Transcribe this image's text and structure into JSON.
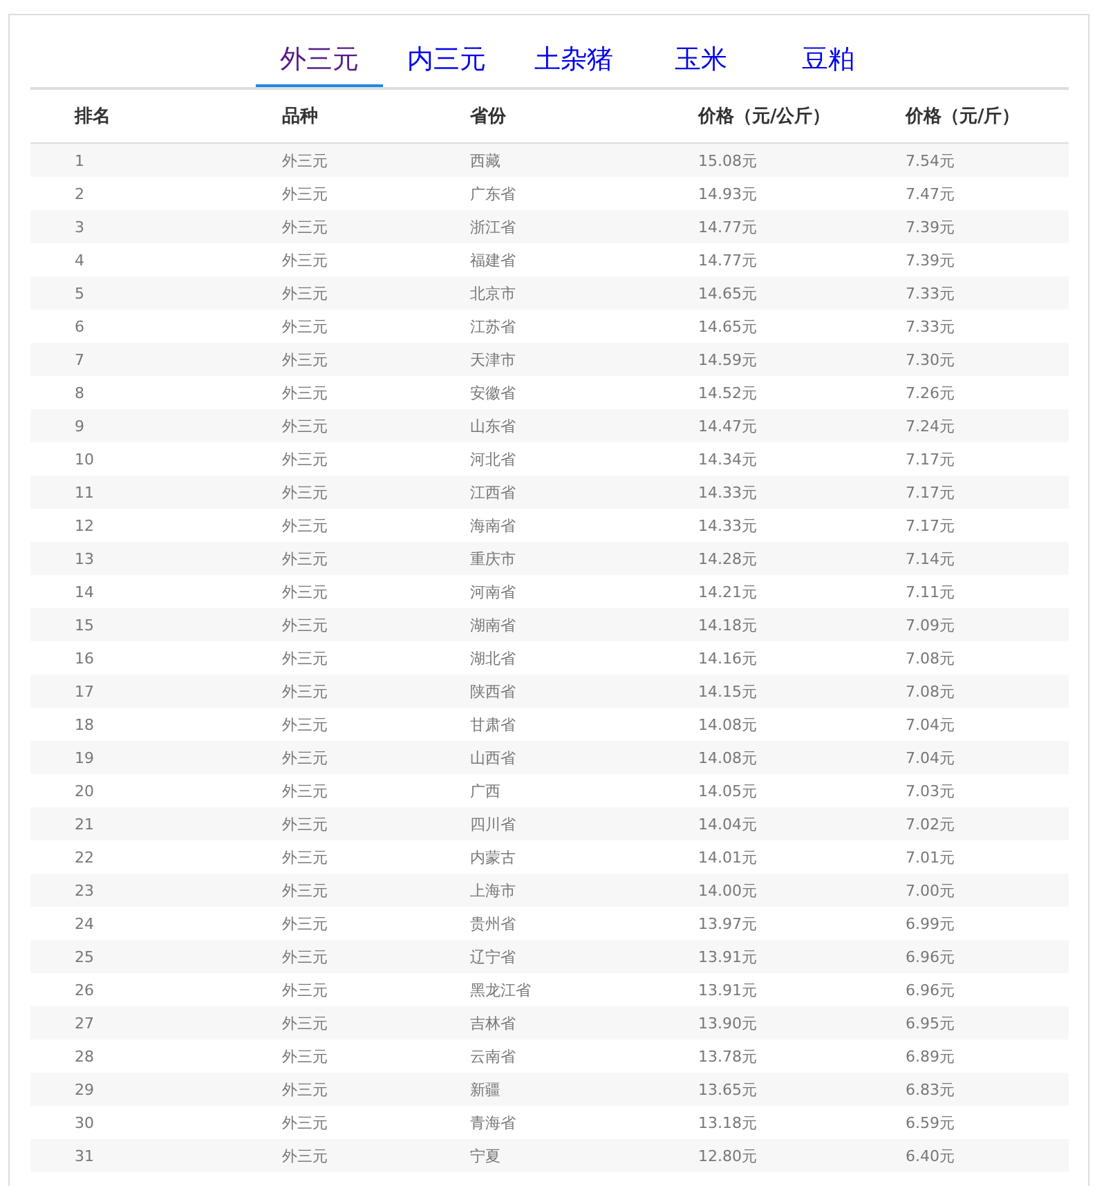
{
  "tabs": [
    {
      "label": "外三元",
      "selected": true
    },
    {
      "label": "内三元",
      "selected": false
    },
    {
      "label": "土杂猪",
      "selected": false
    },
    {
      "label": "玉米",
      "selected": false
    },
    {
      "label": "豆粕",
      "selected": false
    }
  ],
  "table": {
    "columns": [
      "排名",
      "品种",
      "省份",
      "价格（元/公斤）",
      "价格（元/斤）"
    ],
    "rows": [
      [
        "1",
        "外三元",
        "西藏",
        "15.08元",
        "7.54元"
      ],
      [
        "2",
        "外三元",
        "广东省",
        "14.93元",
        "7.47元"
      ],
      [
        "3",
        "外三元",
        "浙江省",
        "14.77元",
        "7.39元"
      ],
      [
        "4",
        "外三元",
        "福建省",
        "14.77元",
        "7.39元"
      ],
      [
        "5",
        "外三元",
        "北京市",
        "14.65元",
        "7.33元"
      ],
      [
        "6",
        "外三元",
        "江苏省",
        "14.65元",
        "7.33元"
      ],
      [
        "7",
        "外三元",
        "天津市",
        "14.59元",
        "7.30元"
      ],
      [
        "8",
        "外三元",
        "安徽省",
        "14.52元",
        "7.26元"
      ],
      [
        "9",
        "外三元",
        "山东省",
        "14.47元",
        "7.24元"
      ],
      [
        "10",
        "外三元",
        "河北省",
        "14.34元",
        "7.17元"
      ],
      [
        "11",
        "外三元",
        "江西省",
        "14.33元",
        "7.17元"
      ],
      [
        "12",
        "外三元",
        "海南省",
        "14.33元",
        "7.17元"
      ],
      [
        "13",
        "外三元",
        "重庆市",
        "14.28元",
        "7.14元"
      ],
      [
        "14",
        "外三元",
        "河南省",
        "14.21元",
        "7.11元"
      ],
      [
        "15",
        "外三元",
        "湖南省",
        "14.18元",
        "7.09元"
      ],
      [
        "16",
        "外三元",
        "湖北省",
        "14.16元",
        "7.08元"
      ],
      [
        "17",
        "外三元",
        "陕西省",
        "14.15元",
        "7.08元"
      ],
      [
        "18",
        "外三元",
        "甘肃省",
        "14.08元",
        "7.04元"
      ],
      [
        "19",
        "外三元",
        "山西省",
        "14.08元",
        "7.04元"
      ],
      [
        "20",
        "外三元",
        "广西",
        "14.05元",
        "7.03元"
      ],
      [
        "21",
        "外三元",
        "四川省",
        "14.04元",
        "7.02元"
      ],
      [
        "22",
        "外三元",
        "内蒙古",
        "14.01元",
        "7.01元"
      ],
      [
        "23",
        "外三元",
        "上海市",
        "14.00元",
        "7.00元"
      ],
      [
        "24",
        "外三元",
        "贵州省",
        "13.97元",
        "6.99元"
      ],
      [
        "25",
        "外三元",
        "辽宁省",
        "13.91元",
        "6.96元"
      ],
      [
        "26",
        "外三元",
        "黑龙江省",
        "13.91元",
        "6.96元"
      ],
      [
        "27",
        "外三元",
        "吉林省",
        "13.90元",
        "6.95元"
      ],
      [
        "28",
        "外三元",
        "云南省",
        "13.78元",
        "6.89元"
      ],
      [
        "29",
        "外三元",
        "新疆",
        "13.65元",
        "6.83元"
      ],
      [
        "30",
        "外三元",
        "青海省",
        "13.18元",
        "6.59元"
      ],
      [
        "31",
        "外三元",
        "宁夏",
        "12.80元",
        "6.40元"
      ]
    ]
  }
}
